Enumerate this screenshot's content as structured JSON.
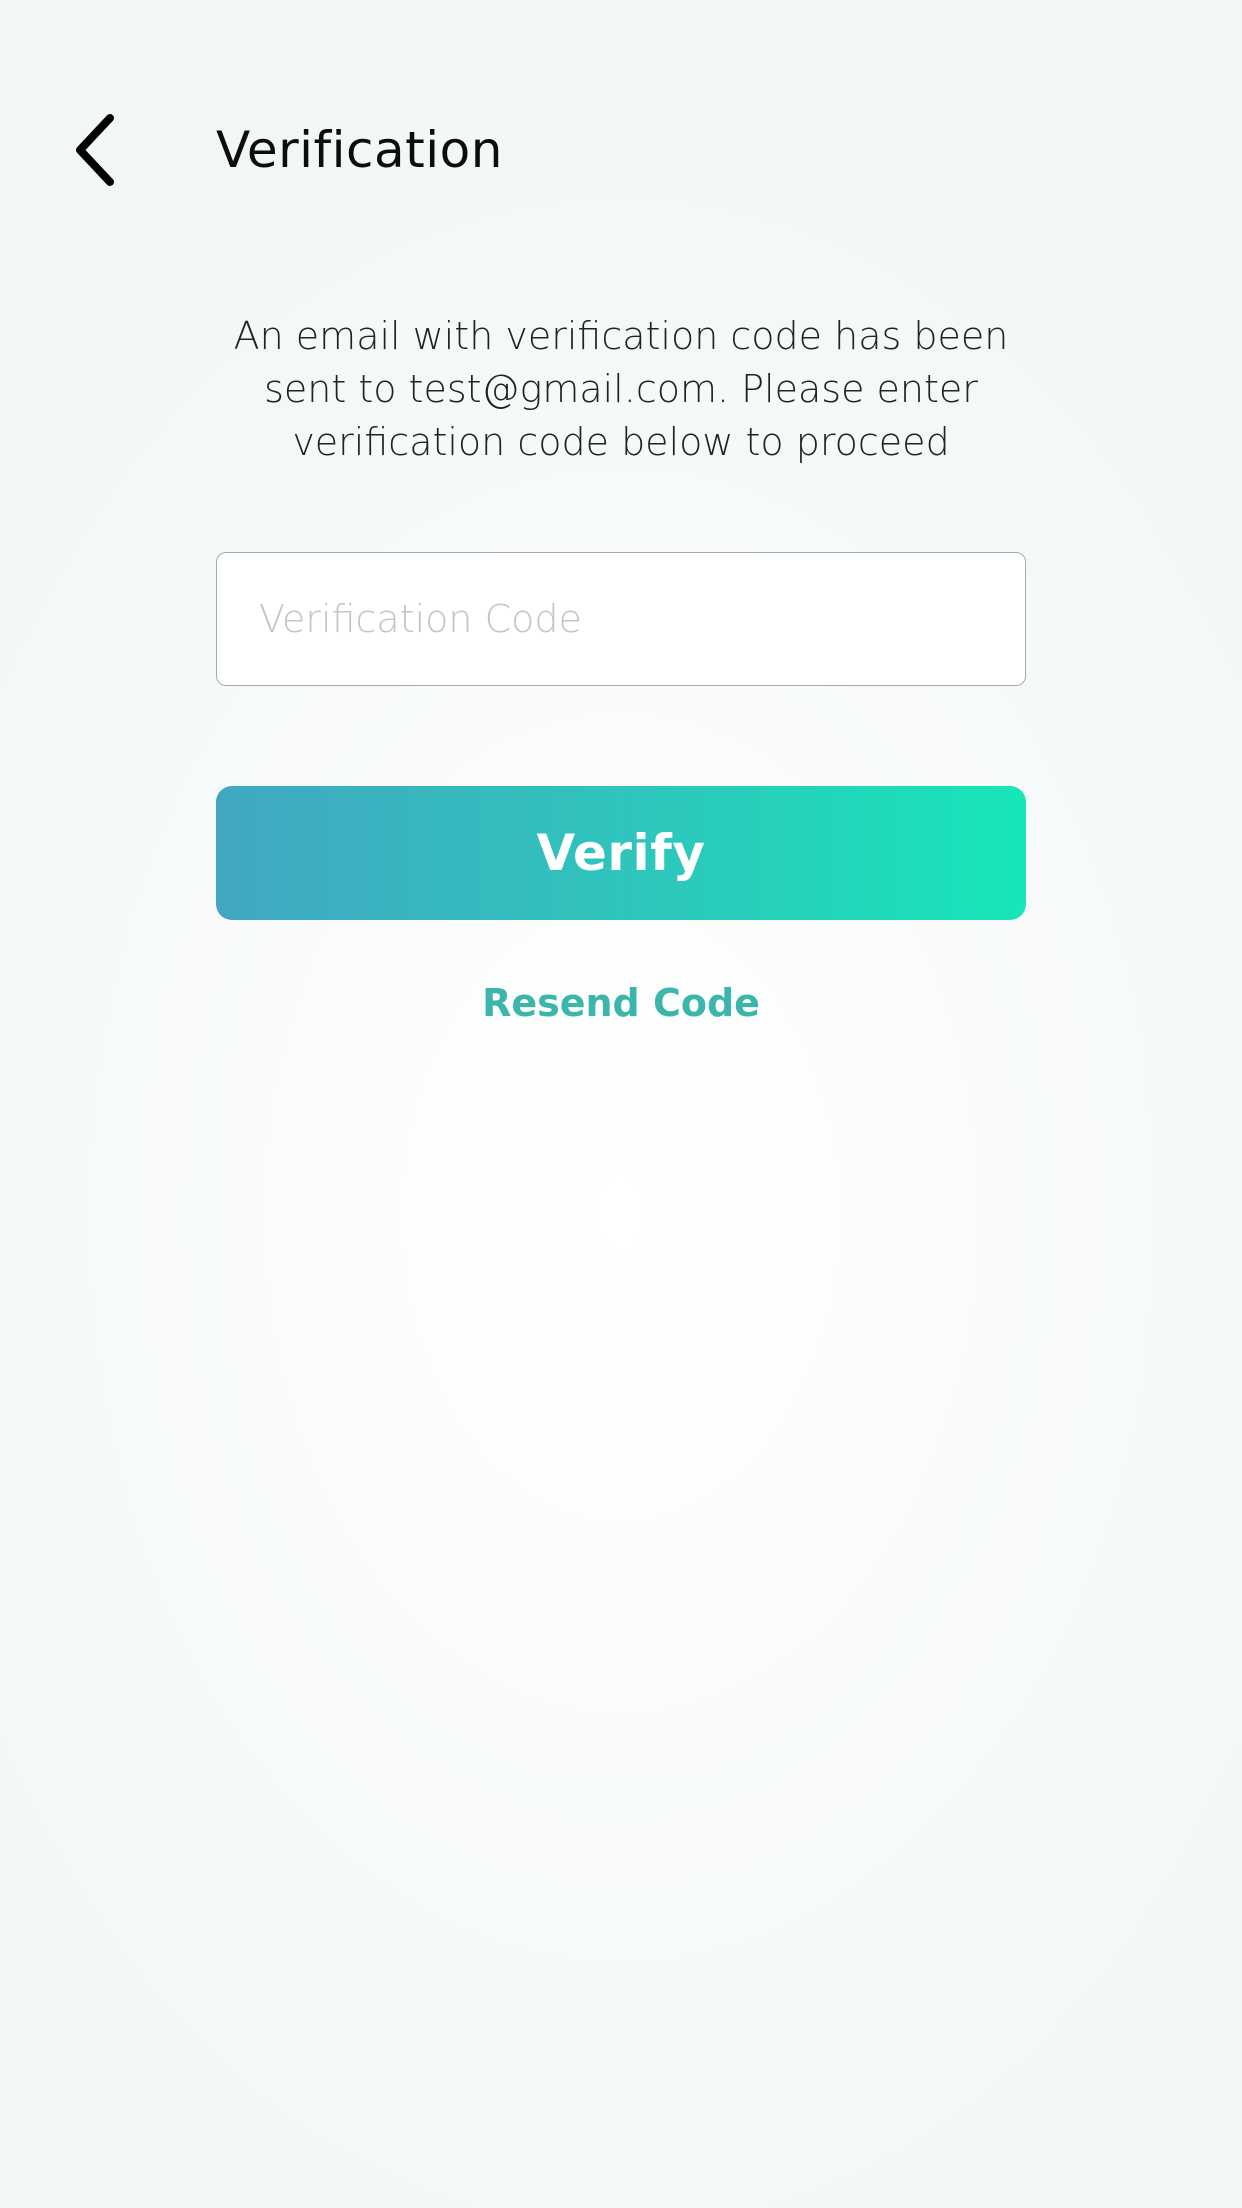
{
  "header": {
    "back_icon": "chevron-left-icon",
    "title": "Verification"
  },
  "main": {
    "message": "An email with verification code has been sent to test@gmail.com. Please enter verification code below to proceed",
    "code_input": {
      "value": "",
      "placeholder": "Verification Code"
    },
    "verify_label": "Verify",
    "resend_label": "Resend Code"
  },
  "colors": {
    "accent_start": "#41a7c1",
    "accent_end": "#17e6b8",
    "link": "#3cb6ab",
    "title": "#0d0d0d"
  }
}
